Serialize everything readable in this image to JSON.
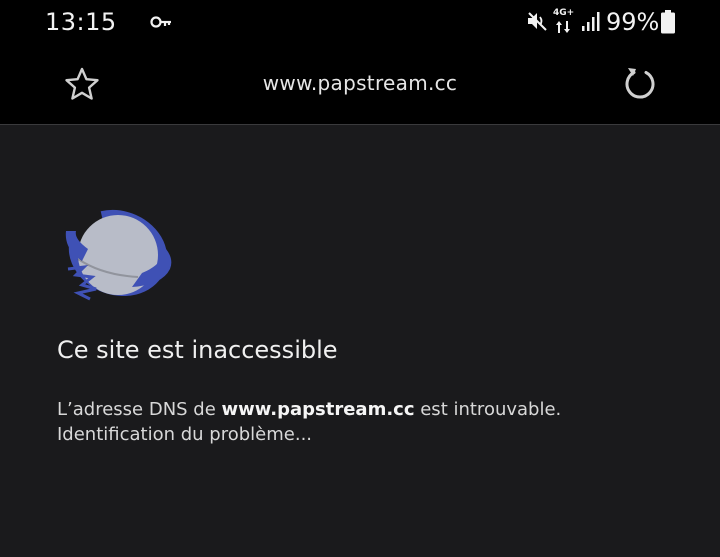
{
  "status_bar": {
    "time": "13:15",
    "network_type": "4G+",
    "battery_percent": "99%",
    "icons": [
      "key-icon",
      "mute-icon",
      "network-icon",
      "signal-icon",
      "battery-icon"
    ]
  },
  "toolbar": {
    "url": "www.papstream.cc",
    "bookmark_icon": "star-icon",
    "reload_icon": "reload-icon"
  },
  "error_page": {
    "icon": "planet-icon",
    "title": "Ce site est inaccessible",
    "message_prefix": "L’adresse DNS de ",
    "message_domain": "www.papstream.cc",
    "message_suffix": " est introuvable.",
    "diagnose_text": "Identification du problème..."
  },
  "colors": {
    "background": "#1a1a1c",
    "bar": "#000000",
    "planet_ring": "#3f51b5",
    "planet_body": "#b8bcc8"
  }
}
